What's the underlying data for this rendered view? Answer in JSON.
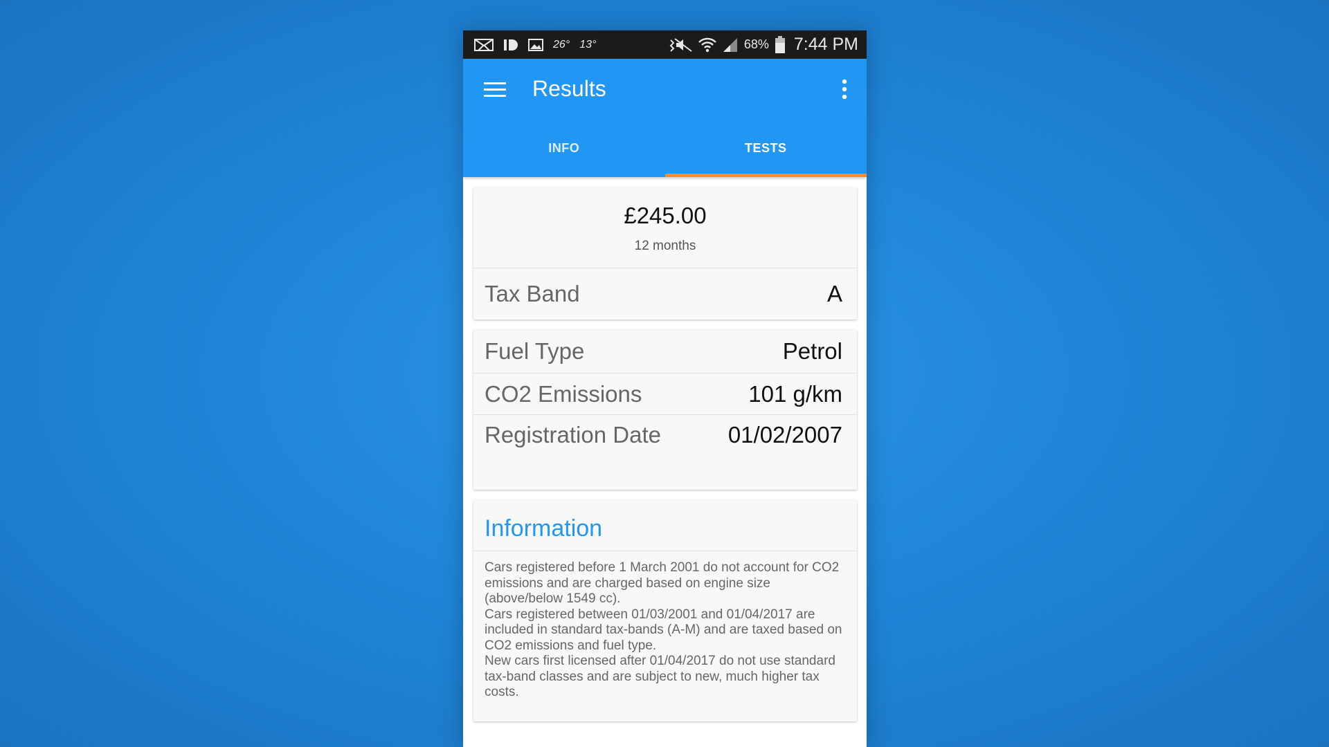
{
  "status_bar": {
    "temp1": "26°",
    "temp2": "13°",
    "battery": "68%",
    "time": "7:44 PM"
  },
  "appbar": {
    "title": "Results",
    "menu_icon": "hamburger-menu-icon",
    "more_icon": "more-vert-icon"
  },
  "tabs": [
    {
      "label": "INFO",
      "active": false
    },
    {
      "label": "TESTS",
      "active": true
    }
  ],
  "tax_card": {
    "price": "£245.00",
    "period": "12 months",
    "band_label": "Tax Band",
    "band_value": "A"
  },
  "details": [
    {
      "label": "Fuel Type",
      "value": "Petrol"
    },
    {
      "label": "CO2 Emissions",
      "value": "101 g/km"
    },
    {
      "label": "Registration Date",
      "value": "01/02/2007"
    }
  ],
  "information": {
    "title": "Information",
    "paragraphs": [
      "Cars registered before 1 March 2001 do not account for CO2 emissions and are charged based on engine size (above/below 1549 cc).",
      "Cars registered between 01/03/2001 and 01/04/2017 are included in standard tax-bands (A-M) and are taxed based on CO2 emissions and fuel type.",
      "New cars first licensed after 01/04/2017 do not use standard tax-band classes and are subject to new, much higher tax costs."
    ]
  },
  "colors": {
    "primary": "#2196f3",
    "tab_indicator": "#ff8a2a",
    "background": "#1f86d9"
  }
}
